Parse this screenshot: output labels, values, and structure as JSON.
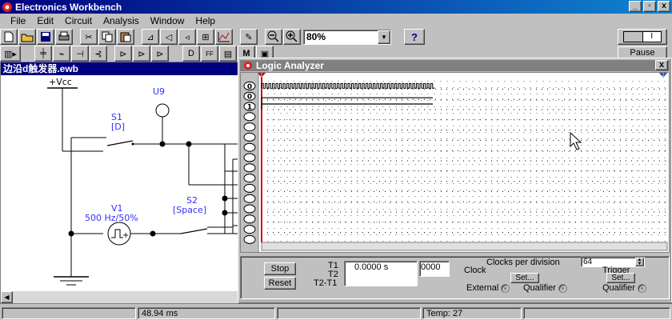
{
  "window": {
    "title": "Electronics Workbench"
  },
  "menu": [
    "File",
    "Edit",
    "Circuit",
    "Analysis",
    "Window",
    "Help"
  ],
  "toolbar": {
    "zoom": "80%",
    "help_label": "?",
    "pause_label": "Pause",
    "power_on": "I"
  },
  "toolbar2_labels": {
    "m_button": "M"
  },
  "circuit": {
    "title": "边沿d触发器.ewb",
    "vcc_label": "+Vcc",
    "u9_label": "U9",
    "s1_label": "S1",
    "s1_key": "[D]",
    "v1_label": "V1",
    "v1_value": "500 Hz/50%",
    "s2_label": "S2",
    "s2_key": "[Space]"
  },
  "status": {
    "time": "48.94 ms",
    "temp": "Temp:  27"
  },
  "logic_analyzer": {
    "title": "Logic Analyzer",
    "channels": [
      "0",
      "0",
      "1",
      "",
      "",
      "",
      "",
      "",
      "",
      "",
      "",
      "",
      "",
      "",
      "",
      ""
    ],
    "stop_label": "Stop",
    "reset_label": "Reset",
    "t1_label": "T1",
    "t2_label": "T2",
    "t2t1_label": "T2-T1",
    "t1_value": "0.0000  s",
    "hex_value": "0000",
    "clocks_per_division_label": "Clocks per division",
    "clocks_per_division_value": "64",
    "clock_label": "Clock",
    "clock_set_label": "Set...",
    "external_label": "External",
    "qualifier_label": "Qualifier",
    "trigger_label": "Trigger",
    "trigger_set_label": "Set...",
    "trigger_qualifier_label": "Qualifier",
    "cursor1_label": "1",
    "cursor2_label": "2"
  },
  "colors": {
    "titlebar": "#000080",
    "inactive_title": "#808080",
    "cursor": "#cc0000",
    "waveform": "#000000"
  }
}
